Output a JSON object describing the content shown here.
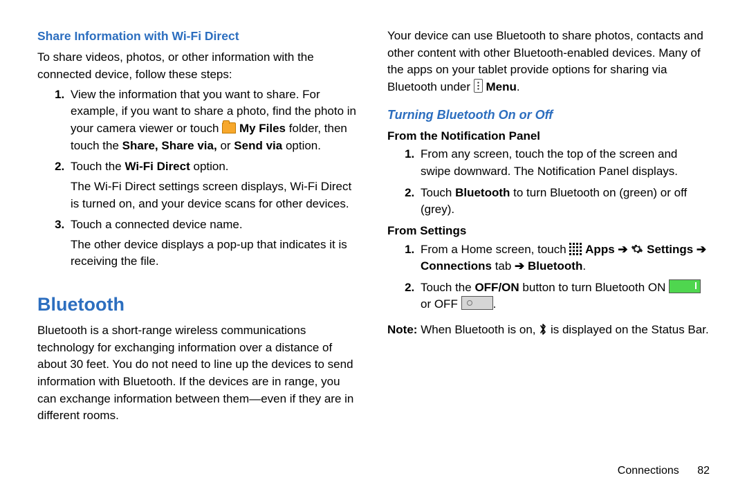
{
  "left": {
    "share_heading": "Share Information with Wi-Fi Direct",
    "share_intro": "To share videos, photos, or other information with the connected device, follow these steps:",
    "li1a": "View the information that you want to share. For example, if you want to share a photo, find the photo in your camera viewer or touch ",
    "my_files": " My Files",
    "li1b": " folder, then touch the ",
    "share_via": "Share, Share via,",
    "or": " or ",
    "send_via": "Send via",
    "li1c": " option.",
    "li2a": "Touch the ",
    "wifi_direct": "Wi-Fi Direct",
    "li2b": " option.",
    "li2c": "The Wi-Fi Direct settings screen displays, Wi-Fi Direct is turned on, and your device scans for other devices.",
    "li3a": "Touch a connected device name.",
    "li3b": "The other device displays a pop-up that indicates it is receiving the file.",
    "bt_heading": "Bluetooth",
    "bt_para": "Bluetooth is a short-range wireless communications technology for exchanging information over a distance of about 30 feet. You do not need to line up the devices to send information with Bluetooth. If the devices are in range, you can exchange information between them—even if they are in different rooms."
  },
  "right": {
    "top": "Your device can use Bluetooth to share photos, contacts and other content with other Bluetooth-enabled devices. Many of the apps on your tablet provide options for sharing via Bluetooth under ",
    "menu": " Menu",
    "turn_heading": "Turning Bluetooth On or Off",
    "sub1": "From the Notification Panel",
    "n1": "From any screen, touch the top of the screen and swipe downward. The Notification Panel displays.",
    "n2a": "Touch ",
    "bt_bold": "Bluetooth",
    "n2b": " to turn Bluetooth on (green) or off (grey).",
    "sub2": "From Settings",
    "s1a": "From a Home screen, touch ",
    "apps": " Apps ",
    "settings": " Settings ",
    "connections": " Connections",
    "tab": " tab ",
    "bt2": " Bluetooth",
    "s2a": "Touch the ",
    "offon": "OFF/ON",
    "s2b": " button to turn Bluetooth ON ",
    "s2c": " or OFF ",
    "note_b": "Note:",
    "note1": " When Bluetooth is on, ",
    "note2": " is displayed on the Status Bar."
  },
  "footer": {
    "chapter": "Connections",
    "page": "82"
  }
}
